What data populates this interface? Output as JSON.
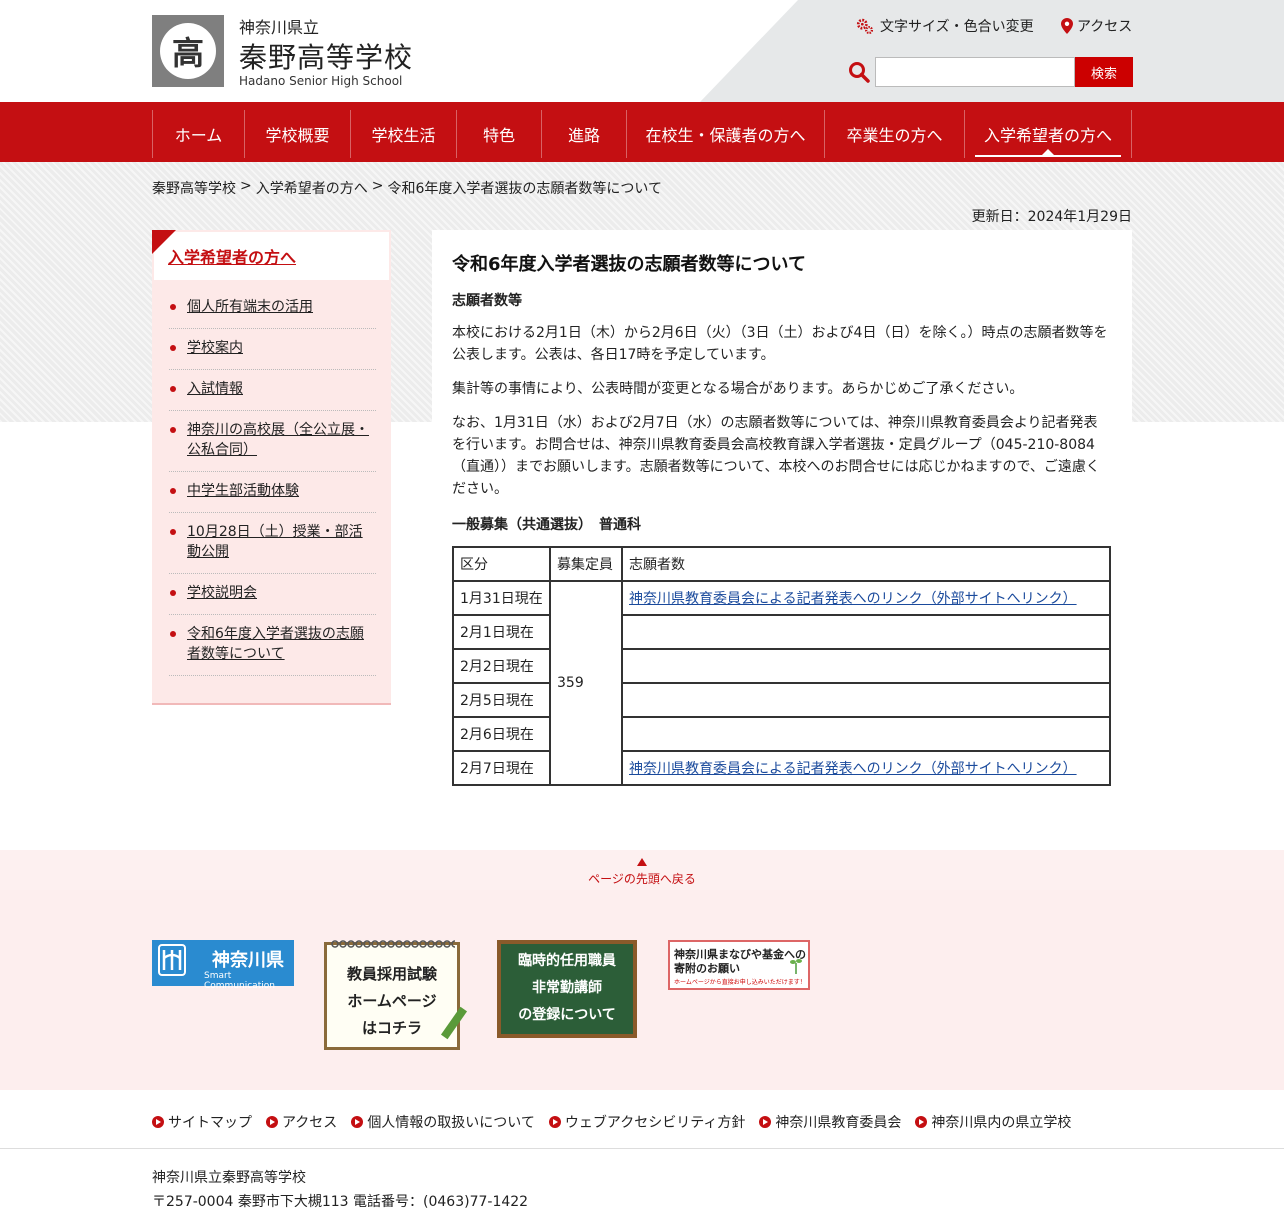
{
  "header": {
    "pref_name": "神奈川県立",
    "school_name": "秦野高等学校",
    "school_name_en": "Hadano Senior High School",
    "logo_glyph": "高",
    "util_fontsize": "文字サイズ・色合い変更",
    "util_access": "アクセス",
    "search_placeholder": "",
    "search_button": "検索"
  },
  "nav": {
    "items": [
      {
        "label": "ホーム"
      },
      {
        "label": "学校概要"
      },
      {
        "label": "学校生活"
      },
      {
        "label": "特色"
      },
      {
        "label": "進路"
      },
      {
        "label": "在校生・保護者の方へ"
      },
      {
        "label": "卒業生の方へ"
      },
      {
        "label": "入学希望者の方へ"
      }
    ],
    "current_index": 7
  },
  "breadcrumb": {
    "items": [
      "秦野高等学校",
      "入学希望者の方へ",
      "令和6年度入学者選抜の志願者数等について"
    ],
    "separator": ">"
  },
  "updated": "更新日：2024年1月29日",
  "side": {
    "heading": "入学希望者の方へ",
    "items": [
      "個人所有端末の活用",
      "学校案内",
      "入試情報",
      "神奈川の高校展（全公立展・公私合同）",
      "中学生部活動体験",
      "10月28日（土）授業・部活動公開",
      "学校説明会",
      "令和6年度入学者選抜の志願者数等について"
    ]
  },
  "main": {
    "title": "令和6年度入学者選抜の志願者数等について",
    "subheading": "志願者数等",
    "para1": "本校における2月1日（木）から2月6日（火）（3日（土）および4日（日）を除く。）時点の志願者数等を公表します。公表は、各日17時を予定しています。",
    "para2": "集計等の事情により、公表時間が変更となる場合があります。あらかじめご了承ください。",
    "para3": "なお、1月31日（水）および2月7日（水）の志願者数等については、神奈川県教育委員会より記者発表を行います。お問合せは、神奈川県教育委員会高校教育課入学者選抜・定員グループ（045-210-8084（直通））までお願いします。志願者数等について、本校へのお問合せには応じかねますので、ご遠慮ください。",
    "table_heading": "一般募集（共通選抜）　普通科",
    "table": {
      "headers": [
        "区分",
        "募集定員",
        "志願者数"
      ],
      "capacity": "359",
      "rows": [
        {
          "date": "1月31日現在",
          "value": "神奈川県教育委員会による記者発表へのリンク（外部サイトへリンク）"
        },
        {
          "date": "2月1日現在",
          "value": ""
        },
        {
          "date": "2月2日現在",
          "value": ""
        },
        {
          "date": "2月5日現在",
          "value": ""
        },
        {
          "date": "2月6日現在",
          "value": ""
        },
        {
          "date": "2月7日現在",
          "value": "神奈川県教育委員会による記者発表へのリンク（外部サイトへリンク）"
        }
      ]
    }
  },
  "footer": {
    "pagetop": "ページの先頭へ戻る",
    "banners": {
      "kanagawa_name": "神奈川県",
      "kanagawa_sub": "Smart Communication",
      "teacher_lines": [
        "教員採用試験",
        "ホームページ",
        "はコチラ"
      ],
      "board_lines": [
        "臨時的任用職員",
        "非常勤講師",
        "の登録について"
      ],
      "fund_lines": [
        "神奈川県まなびや基金への",
        "寄附のお願い"
      ],
      "fund_small": "ホームページから直接お申し込みいただけます！"
    },
    "links": [
      "サイトマップ",
      "アクセス",
      "個人情報の取扱いについて",
      "ウェブアクセシビリティ方針",
      "神奈川県教育委員会",
      "神奈川県内の県立学校"
    ],
    "school": "神奈川県立秦野高等学校",
    "address": "〒257-0004 秦野市下大槻113 電話番号：(0463)77-1422"
  },
  "colors": {
    "brand_red": "#c40f12",
    "link_blue": "#1a4a9c"
  }
}
